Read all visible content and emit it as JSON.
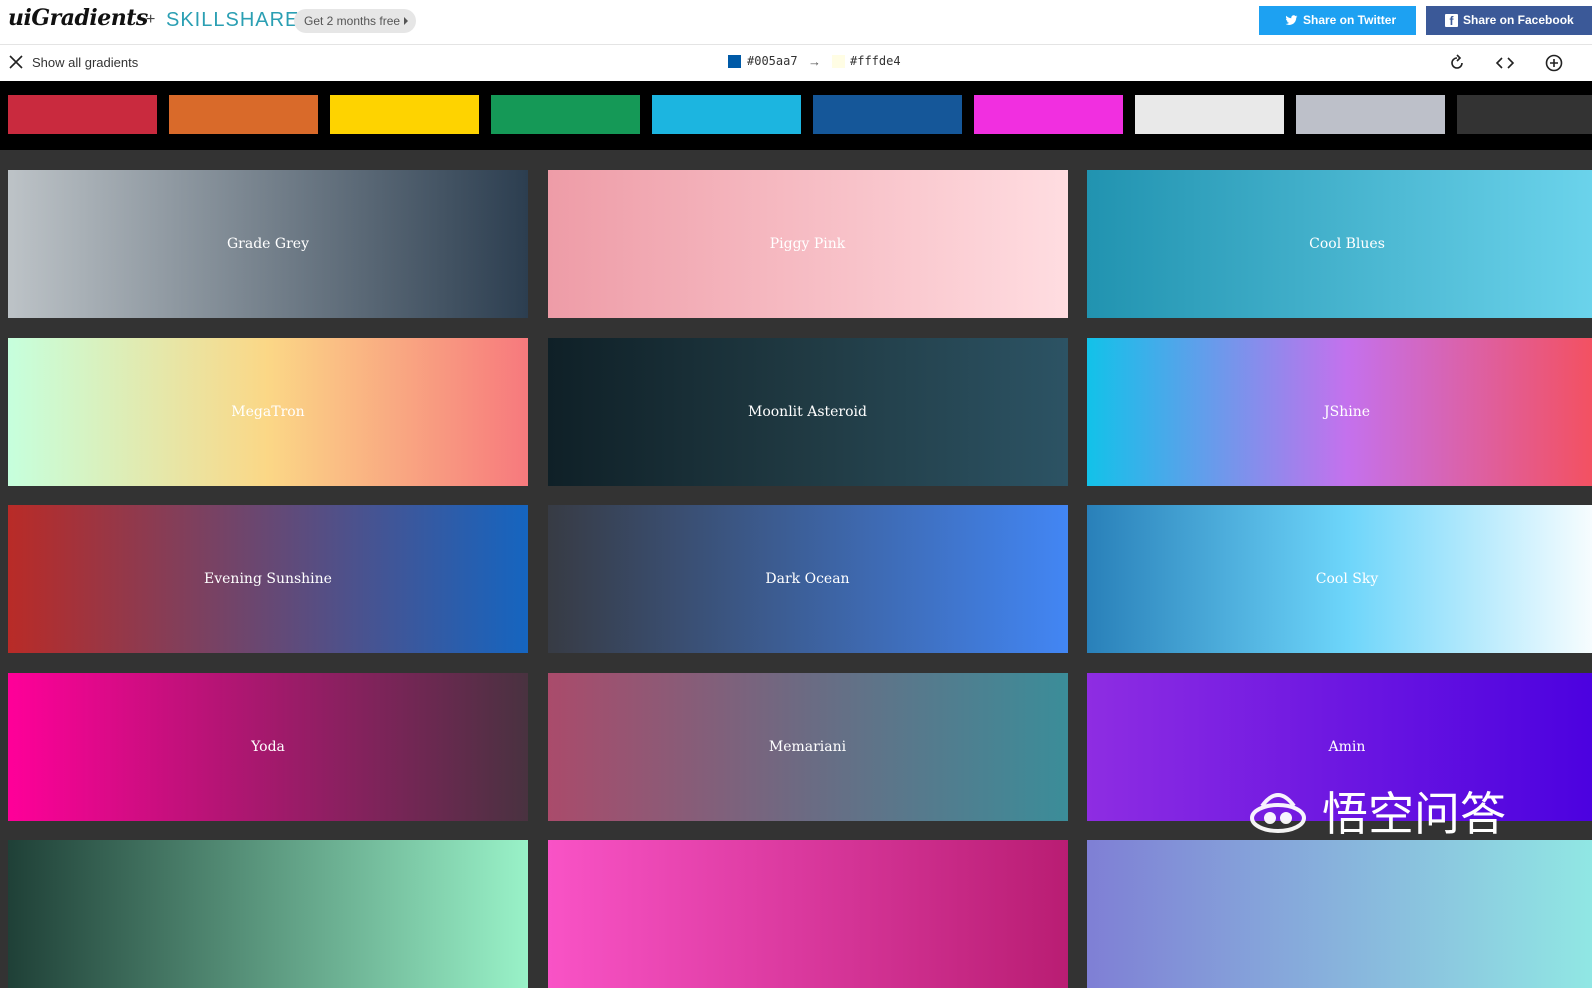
{
  "header": {
    "logo": "uiGradients",
    "plus": "+",
    "partner": "SKILLSHARE",
    "promo_label": "Get 2 months free",
    "share_twitter": "Share on Twitter",
    "share_facebook": "Share on Facebook",
    "twitter_color": "#1da1f2",
    "facebook_color": "#3b5998"
  },
  "toolbar": {
    "show_all_label": "Show all gradients",
    "from_hex": "#005aa7",
    "arrow": "→",
    "to_hex": "#fffde4",
    "icons": [
      "close-icon",
      "rotate-icon",
      "code-icon",
      "add-circle-icon"
    ]
  },
  "filters": [
    {
      "name": "red",
      "color": "#c92a3e"
    },
    {
      "name": "orange",
      "color": "#d96a2a"
    },
    {
      "name": "yellow",
      "color": "#fed300"
    },
    {
      "name": "green",
      "color": "#159957"
    },
    {
      "name": "cyan",
      "color": "#1cb5e0"
    },
    {
      "name": "blue",
      "color": "#155799"
    },
    {
      "name": "magenta",
      "color": "#f12fe0"
    },
    {
      "name": "white",
      "color": "#e9e9e9"
    },
    {
      "name": "grey",
      "color": "#bdc0c9"
    },
    {
      "name": "black",
      "color": "#333333"
    }
  ],
  "gradients": [
    {
      "name": "Grade Grey",
      "from": "#bdc3c7",
      "to": "#2c3e50"
    },
    {
      "name": "Piggy Pink",
      "from": "#ee9ca7",
      "to": "#ffdde1"
    },
    {
      "name": "Cool Blues",
      "from": "#2193b0",
      "to": "#6dd5ed"
    },
    {
      "name": "MegaTron",
      "stops": [
        "#c6ffdd",
        "#fbd786",
        "#f7797d"
      ]
    },
    {
      "name": "Moonlit Asteroid",
      "stops": [
        "#0f2027",
        "#203a43",
        "#2c5364"
      ]
    },
    {
      "name": "JShine",
      "stops": [
        "#12c2e9",
        "#c471ed",
        "#f64f59"
      ]
    },
    {
      "name": "Evening Sunshine",
      "from": "#b92b27",
      "to": "#1565c0"
    },
    {
      "name": "Dark Ocean",
      "from": "#373b44",
      "to": "#4286f4"
    },
    {
      "name": "Cool Sky",
      "stops": [
        "#2980b9",
        "#6dd5fa",
        "#ffffff"
      ]
    },
    {
      "name": "Yoda",
      "stops": [
        "#ff0099",
        "#493240"
      ]
    },
    {
      "name": "Memariani",
      "stops": [
        "#aa4b6b",
        "#6b6b83",
        "#3b8d99"
      ]
    },
    {
      "name": "Amin",
      "from": "#8e2de2",
      "to": "#4a00e0"
    },
    {
      "name": "",
      "from": "#1f4037",
      "to": "#99f2c8"
    },
    {
      "name": "",
      "from": "#f953c6",
      "to": "#b91d73"
    },
    {
      "name": "",
      "from": "#7f7fd5",
      "to": "#91eae4"
    }
  ],
  "watermark": "悟空问答"
}
